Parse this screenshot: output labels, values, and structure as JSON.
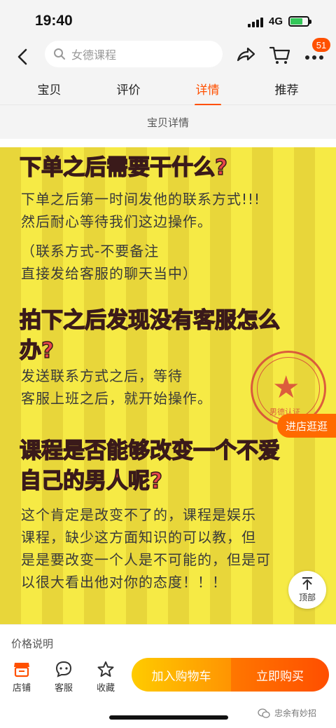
{
  "status": {
    "time": "19:40",
    "network": "4G"
  },
  "nav": {
    "search_placeholder": "女德课程",
    "cart_badge": "51"
  },
  "tabs": [
    {
      "label": "宝贝",
      "active": false
    },
    {
      "label": "评价",
      "active": false
    },
    {
      "label": "详情",
      "active": true
    },
    {
      "label": "推荐",
      "active": false
    }
  ],
  "section_title": "宝贝详情",
  "content": {
    "q1": {
      "heading": "下单之后需要干什么?",
      "lines": [
        "下单之后第一时间发他的联系方式!!!",
        "然后耐心等待我们这边操作。"
      ],
      "note": [
        "（联系方式-不要备注",
        "直接发给客服的聊天当中）"
      ]
    },
    "q2": {
      "heading_lines": [
        "拍下之后发现没有客服怎么",
        "办?"
      ],
      "lines": [
        "发送联系方式之后，等待",
        "客服上班之后，就开始操作。"
      ]
    },
    "q3": {
      "heading_lines": [
        "课程是否能够改变一个不爱",
        "自己的男人呢?"
      ],
      "lines": [
        "这个肯定是改变不了的，课程是娱乐",
        "课程，缺少这方面知识的可以教，但",
        "是是要改变一个人是不可能的，但是可",
        "以很大看出他对你的态度！！！"
      ]
    },
    "stamp_text": "男德认证"
  },
  "floating": {
    "visit_store": "进店逛逛",
    "to_top": "顶部"
  },
  "price_label": "价格说明",
  "actions": [
    {
      "label": "店铺",
      "icon": "store-icon"
    },
    {
      "label": "客服",
      "icon": "chat-icon"
    },
    {
      "label": "收藏",
      "icon": "star-icon"
    }
  ],
  "buttons": {
    "add_to_cart": "加入购物车",
    "buy_now": "立即购买"
  },
  "watermark": "忠余有妙招",
  "colors": {
    "accent": "#ff5000",
    "content_bg": "#f6ea45",
    "heading": "#e8474a"
  }
}
